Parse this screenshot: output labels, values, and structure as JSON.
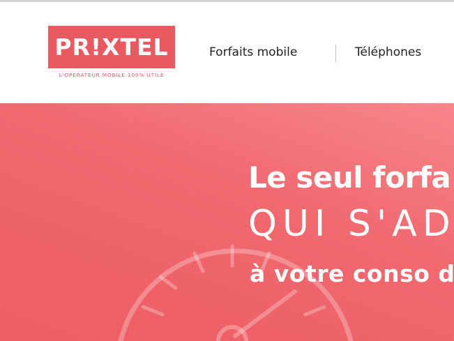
{
  "header": {
    "logo": {
      "text": "PR!XTEL",
      "tagline": "L'OPÉRATEUR MOBILE 100% UTILE"
    },
    "nav": [
      {
        "label": "Forfaits mobile"
      },
      {
        "label": "Téléphones"
      }
    ]
  },
  "hero": {
    "line1": "Le seul forfa",
    "line2": "QUI S'AD",
    "line3": "à votre conso d"
  },
  "colors": {
    "brand": "#e9595f",
    "hero_background": "#ee6168",
    "text_dark": "#222222"
  }
}
